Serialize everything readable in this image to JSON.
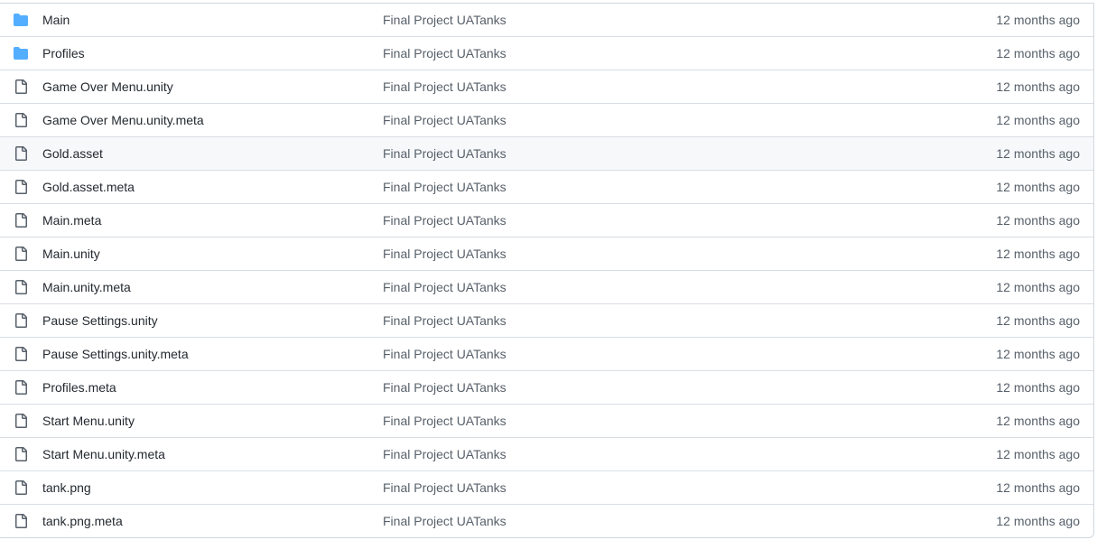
{
  "colors": {
    "folder_icon": "#54aeff",
    "file_icon": "#57606a",
    "row_border": "#d8dee4",
    "hover_row": "#f6f8fa"
  },
  "files": [
    {
      "type": "folder",
      "icon": "folder-icon",
      "name": "Main",
      "commit": "Final Project UATanks",
      "age": "12 months ago"
    },
    {
      "type": "folder",
      "icon": "folder-icon",
      "name": "Profiles",
      "commit": "Final Project UATanks",
      "age": "12 months ago"
    },
    {
      "type": "file",
      "icon": "file-icon",
      "name": "Game Over Menu.unity",
      "commit": "Final Project UATanks",
      "age": "12 months ago"
    },
    {
      "type": "file",
      "icon": "file-icon",
      "name": "Game Over Menu.unity.meta",
      "commit": "Final Project UATanks",
      "age": "12 months ago"
    },
    {
      "type": "file",
      "icon": "file-icon",
      "name": "Gold.asset",
      "commit": "Final Project UATanks",
      "age": "12 months ago",
      "highlighted": true
    },
    {
      "type": "file",
      "icon": "file-icon",
      "name": "Gold.asset.meta",
      "commit": "Final Project UATanks",
      "age": "12 months ago"
    },
    {
      "type": "file",
      "icon": "file-icon",
      "name": "Main.meta",
      "commit": "Final Project UATanks",
      "age": "12 months ago"
    },
    {
      "type": "file",
      "icon": "file-icon",
      "name": "Main.unity",
      "commit": "Final Project UATanks",
      "age": "12 months ago"
    },
    {
      "type": "file",
      "icon": "file-icon",
      "name": "Main.unity.meta",
      "commit": "Final Project UATanks",
      "age": "12 months ago"
    },
    {
      "type": "file",
      "icon": "file-icon",
      "name": "Pause Settings.unity",
      "commit": "Final Project UATanks",
      "age": "12 months ago"
    },
    {
      "type": "file",
      "icon": "file-icon",
      "name": "Pause Settings.unity.meta",
      "commit": "Final Project UATanks",
      "age": "12 months ago"
    },
    {
      "type": "file",
      "icon": "file-icon",
      "name": "Profiles.meta",
      "commit": "Final Project UATanks",
      "age": "12 months ago"
    },
    {
      "type": "file",
      "icon": "file-icon",
      "name": "Start Menu.unity",
      "commit": "Final Project UATanks",
      "age": "12 months ago"
    },
    {
      "type": "file",
      "icon": "file-icon",
      "name": "Start Menu.unity.meta",
      "commit": "Final Project UATanks",
      "age": "12 months ago"
    },
    {
      "type": "file",
      "icon": "file-icon",
      "name": "tank.png",
      "commit": "Final Project UATanks",
      "age": "12 months ago"
    },
    {
      "type": "file",
      "icon": "file-icon",
      "name": "tank.png.meta",
      "commit": "Final Project UATanks",
      "age": "12 months ago"
    }
  ]
}
